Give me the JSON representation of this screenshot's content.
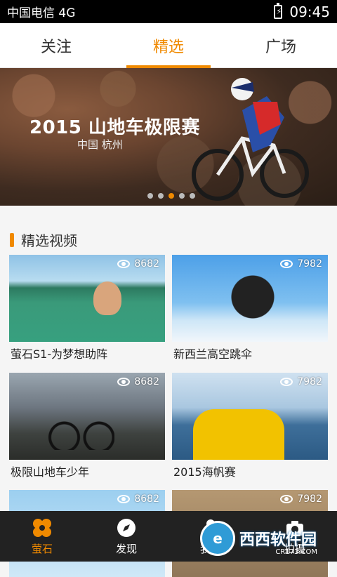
{
  "status": {
    "carrier": "中国电信 4G",
    "time": "09:45"
  },
  "tabs": [
    {
      "label": "关注",
      "active": false
    },
    {
      "label": "精选",
      "active": true
    },
    {
      "label": "广场",
      "active": false
    }
  ],
  "banner": {
    "title": "2015 山地车极限赛",
    "subtitle": "中国  杭州",
    "dots": 5,
    "active_dot": 2
  },
  "section": {
    "title": "精选视频"
  },
  "videos": [
    {
      "title": "萤石S1-为梦想助阵",
      "views": "8682"
    },
    {
      "title": "新西兰高空跳伞",
      "views": "7982"
    },
    {
      "title": "极限山地车少年",
      "views": "8682"
    },
    {
      "title": "2015海帆赛",
      "views": "7982"
    },
    {
      "title": "",
      "views": "8682"
    },
    {
      "title": "",
      "views": "7982"
    }
  ],
  "bottom_nav": [
    {
      "label": "萤石",
      "icon": "ezviz-flower-icon",
      "active": true
    },
    {
      "label": "发现",
      "icon": "compass-icon",
      "active": false
    },
    {
      "label": "我的",
      "icon": "person-icon",
      "active": false
    },
    {
      "label": "拍摄",
      "icon": "camera-icon",
      "active": false
    }
  ],
  "watermark": {
    "text": "西西软件园",
    "sub": "CR173.COM",
    "badge": "e"
  },
  "colors": {
    "accent": "#f08a00",
    "nav_bg": "#222222"
  }
}
